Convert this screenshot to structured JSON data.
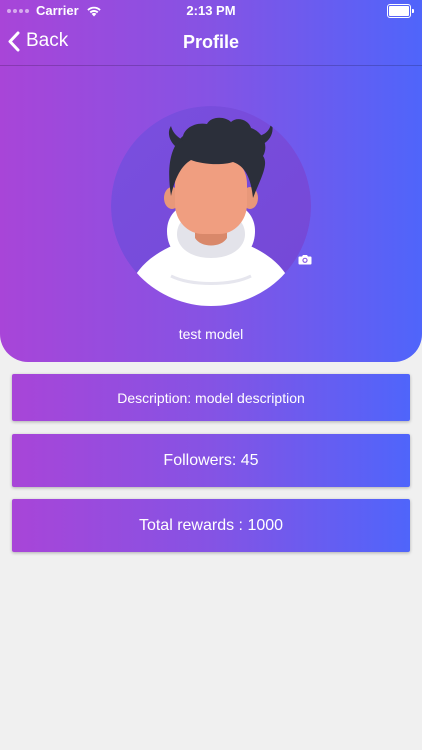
{
  "status_bar": {
    "carrier": "Carrier",
    "time": "2:13 PM",
    "wifi_icon": "wifi-icon",
    "battery_icon": "battery-icon",
    "signal_icon": "signal-dots-icon"
  },
  "nav": {
    "back_label": "Back",
    "back_icon": "chevron-left-icon",
    "title": "Profile"
  },
  "profile": {
    "avatar_icon": "default-avatar-illustration",
    "camera_icon": "camera-icon",
    "name": "test model"
  },
  "cards": {
    "description": "Description: model description",
    "followers": "Followers: 45",
    "rewards": "Total rewards : 1000"
  },
  "colors": {
    "gradient_start": "#a845d8",
    "gradient_mid": "#8553e4",
    "gradient_end": "#4f65fb",
    "background": "#f0f0f0",
    "text": "#ffffff"
  }
}
